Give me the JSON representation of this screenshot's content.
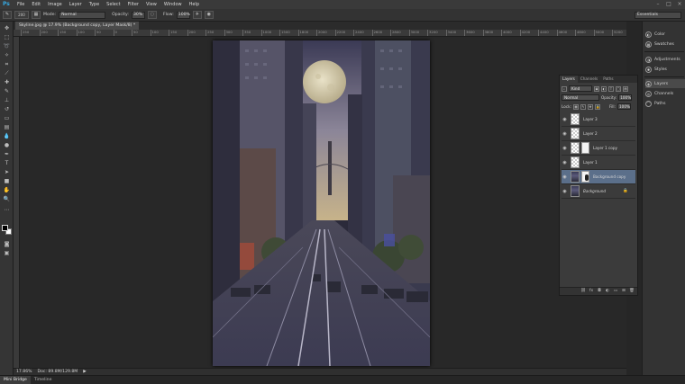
{
  "app": {
    "logo": "Ps"
  },
  "menu": [
    "File",
    "Edit",
    "Image",
    "Layer",
    "Type",
    "Select",
    "Filter",
    "View",
    "Window",
    "Help"
  ],
  "window_controls": [
    "–",
    "□",
    "×"
  ],
  "options_bar": {
    "brush_size": "200",
    "mode_label": "Mode:",
    "mode_value": "Normal",
    "opacity_label": "Opacity:",
    "opacity_value": "30%",
    "flow_label": "Flow:",
    "flow_value": "100%",
    "workspace": "Essentials"
  },
  "document": {
    "tab_title": "Skyline.jpg @ 17.9% (Background copy, Layer Mask/8) *",
    "zoom": "17.86%",
    "doc_info": "Doc: 89.8M/129.8M"
  },
  "ruler_ticks": [
    "250",
    "200",
    "150",
    "100",
    "50",
    "0",
    "50",
    "100",
    "150",
    "200",
    "250",
    "300",
    "350",
    "1000",
    "1500",
    "1800",
    "2000",
    "2200",
    "2400",
    "2600",
    "2800",
    "3000",
    "3200",
    "3400",
    "3600",
    "3800",
    "4000",
    "4200",
    "4400",
    "4600",
    "4800",
    "5000",
    "5200"
  ],
  "panel_icons": [
    {
      "label": "Color",
      "icon": "color-icon"
    },
    {
      "label": "Swatches",
      "icon": "swatches-icon"
    },
    {
      "label": "Adjustments",
      "icon": "adjustments-icon"
    },
    {
      "label": "Styles",
      "icon": "styles-icon"
    },
    {
      "label": "Layers",
      "icon": "layers-icon"
    },
    {
      "label": "Channels",
      "icon": "channels-icon"
    },
    {
      "label": "Paths",
      "icon": "paths-icon"
    }
  ],
  "layers_panel": {
    "tabs": [
      "Layers",
      "Channels",
      "Paths"
    ],
    "filter_kind": "Kind",
    "blend_mode": "Normal",
    "opacity_label": "Opacity:",
    "opacity_value": "100%",
    "lock_label": "Lock:",
    "fill_label": "Fill:",
    "fill_value": "100%",
    "layers": [
      {
        "name": "Layer 3",
        "type": "transparent",
        "mask": false
      },
      {
        "name": "Layer 2",
        "type": "transparent",
        "mask": false
      },
      {
        "name": "Layer 1 copy",
        "type": "transparent",
        "mask": true
      },
      {
        "name": "Layer 1",
        "type": "transparent",
        "mask": false
      },
      {
        "name": "Background copy",
        "type": "photo",
        "mask": true,
        "selected": true
      },
      {
        "name": "Background",
        "type": "photo",
        "mask": false,
        "locked": true
      }
    ]
  },
  "bottom_tabs": [
    "Mini Bridge",
    "Timeline"
  ]
}
